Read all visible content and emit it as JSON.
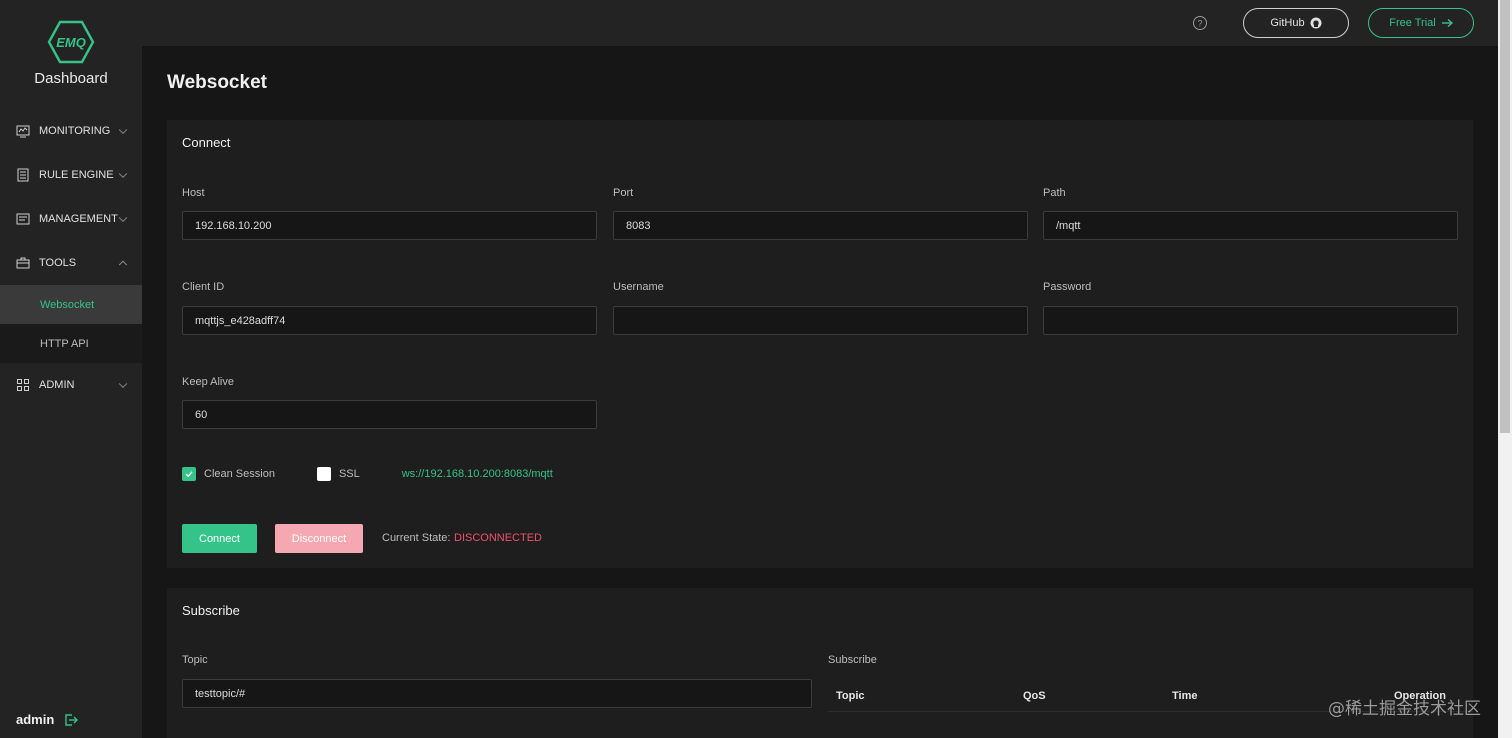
{
  "brand": {
    "logo_text": "EMQ",
    "title": "Dashboard"
  },
  "colors": {
    "accent": "#34c388",
    "danger": "#f0506e",
    "disconnect_bg": "#f5a8b1"
  },
  "sidebar": {
    "items": [
      {
        "label": "MONITORING",
        "icon": "monitoring-icon",
        "expanded": false
      },
      {
        "label": "RULE ENGINE",
        "icon": "rule-engine-icon",
        "expanded": false
      },
      {
        "label": "MANAGEMENT",
        "icon": "management-icon",
        "expanded": false
      },
      {
        "label": "TOOLS",
        "icon": "tools-icon",
        "expanded": true
      },
      {
        "label": "ADMIN",
        "icon": "admin-grid-icon",
        "expanded": false
      }
    ],
    "tools_sub": [
      {
        "label": "Websocket",
        "active": true
      },
      {
        "label": "HTTP API",
        "active": false
      }
    ],
    "user": "admin"
  },
  "header": {
    "github_label": "GitHub",
    "trial_label": "Free Trial"
  },
  "page": {
    "title": "Websocket"
  },
  "connect": {
    "title": "Connect",
    "host_label": "Host",
    "host_value": "192.168.10.200",
    "port_label": "Port",
    "port_value": "8083",
    "path_label": "Path",
    "path_value": "/mqtt",
    "client_id_label": "Client ID",
    "client_id_value": "mqttjs_e428adff74",
    "username_label": "Username",
    "username_value": "",
    "password_label": "Password",
    "password_value": "",
    "keep_alive_label": "Keep Alive",
    "keep_alive_value": "60",
    "clean_session_label": "Clean Session",
    "clean_session_checked": true,
    "ssl_label": "SSL",
    "ssl_checked": false,
    "ws_url": "ws://192.168.10.200:8083/mqtt",
    "connect_label": "Connect",
    "disconnect_label": "Disconnect",
    "state_label": "Current State:",
    "state_value": "DISCONNECTED"
  },
  "subscribe": {
    "title": "Subscribe",
    "topic_label": "Topic",
    "topic_value": "testtopic/#",
    "list_label": "Subscribe",
    "columns": [
      "Topic",
      "QoS",
      "Time",
      "Operation"
    ]
  },
  "watermark": "@稀土掘金技术社区"
}
